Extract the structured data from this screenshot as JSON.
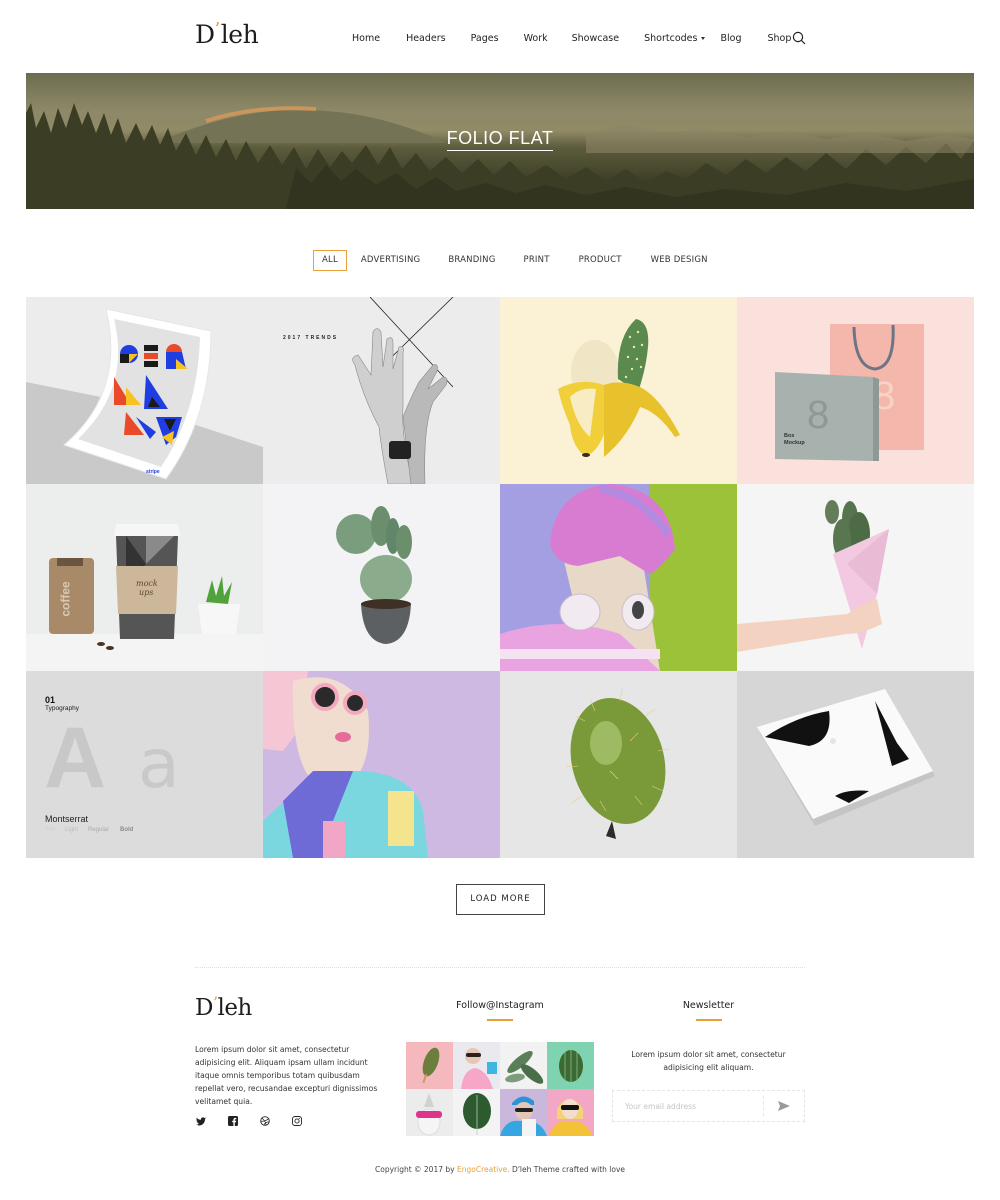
{
  "header": {
    "logo": {
      "prefix": "D",
      "apostrophe": "’",
      "suffix": "leh"
    },
    "nav": [
      {
        "label": "Home"
      },
      {
        "label": "Headers"
      },
      {
        "label": "Pages"
      },
      {
        "label": "Work"
      },
      {
        "label": "Showcase"
      },
      {
        "label": "Shortcodes",
        "has_dropdown": true
      },
      {
        "label": "Blog"
      },
      {
        "label": "Shop"
      }
    ],
    "search_icon": "search-icon"
  },
  "hero": {
    "title": "FOLIO FLAT"
  },
  "filters": [
    {
      "label": "ALL",
      "active": true
    },
    {
      "label": "ADVERTISING"
    },
    {
      "label": "BRANDING"
    },
    {
      "label": "PRINT"
    },
    {
      "label": "PRODUCT"
    },
    {
      "label": "WEB DESIGN"
    }
  ],
  "portfolio": {
    "items": [
      {
        "subject": "germany-poster",
        "bg": "#ececec"
      },
      {
        "subject": "hands-2017-trends",
        "text": "2017 TRENDS",
        "bg": "#ececec"
      },
      {
        "subject": "banana-cactus",
        "bg": "#fbf1d4"
      },
      {
        "subject": "box-and-bag-mockup",
        "box_number": "8",
        "box_label_line1": "Box",
        "box_label_line2": "Mockup",
        "bg": "#fbe1db"
      },
      {
        "subject": "coffee-cup-mockup",
        "cup_text_line1": "mock",
        "cup_text_line2": "ups",
        "bag_text": "coffee",
        "bg": "#eceeed"
      },
      {
        "subject": "potted-cactus",
        "bg": "#f3f3f5"
      },
      {
        "subject": "pink-hair-headphones",
        "bg": "#a49ee3"
      },
      {
        "subject": "cactus-paper-cone",
        "bg": "#f5f5f5"
      },
      {
        "subject": "typography-card",
        "number": "01",
        "title": "Typography",
        "glyph_big": "A",
        "glyph_small": "a",
        "font_name": "Montserrat",
        "weights": [
          "Thin",
          "Light",
          "Regular",
          "Bold"
        ],
        "bg": "#dcdcdc"
      },
      {
        "subject": "pink-sunglasses-woman",
        "bg": "#cdb9e2"
      },
      {
        "subject": "cactus-balloon",
        "bg": "#e6e6e6"
      },
      {
        "subject": "abstract-print-mockup",
        "bg": "#d6d6d6"
      }
    ],
    "load_more_label": "LOAD MORE"
  },
  "footer": {
    "logo": {
      "prefix": "D",
      "apostrophe": "’",
      "suffix": "leh"
    },
    "about": "Lorem ipsum dolor sit amet, consectetur adipisicing elit. Aliquam ipsam ullam incidunt itaque omnis temporibus totam quibusdam repellat vero, recusandae excepturi dignissimos velitamet quia.",
    "socials": [
      {
        "icon": "twitter-icon"
      },
      {
        "icon": "facebook-icon"
      },
      {
        "icon": "dribbble-icon"
      },
      {
        "icon": "instagram-icon"
      }
    ],
    "instagram": {
      "heading": "Follow@Instagram",
      "photos": [
        {
          "subject": "cactus-popsicle",
          "bg": "#f4b8bd"
        },
        {
          "subject": "woman-pink-shirt",
          "bg": "#e9e9ef"
        },
        {
          "subject": "leaves",
          "bg": "#f2f2f2"
        },
        {
          "subject": "cactus-mint",
          "bg": "#7fd3b0"
        },
        {
          "subject": "pineapple-sunglasses",
          "bg": "#ececec"
        },
        {
          "subject": "monstera-leaf",
          "bg": "#f3f3f3"
        },
        {
          "subject": "man-blue-beanie",
          "bg": "#c9b8dc"
        },
        {
          "subject": "woman-yellow-jacket",
          "bg": "#f2a7c4"
        }
      ]
    },
    "newsletter": {
      "heading": "Newsletter",
      "text": "Lorem ipsum dolor sit amet, consectetur adipisicing elit aliquam.",
      "placeholder": "Your email address",
      "send_icon": "send-icon"
    },
    "copyright": {
      "prefix": "Copyright © 2017 by ",
      "brand": "EngoCreative.",
      "suffix": " D'leh Theme crafted with love"
    }
  },
  "colors": {
    "accent": "#e8a13a",
    "text": "#222222",
    "border": "#444444"
  }
}
